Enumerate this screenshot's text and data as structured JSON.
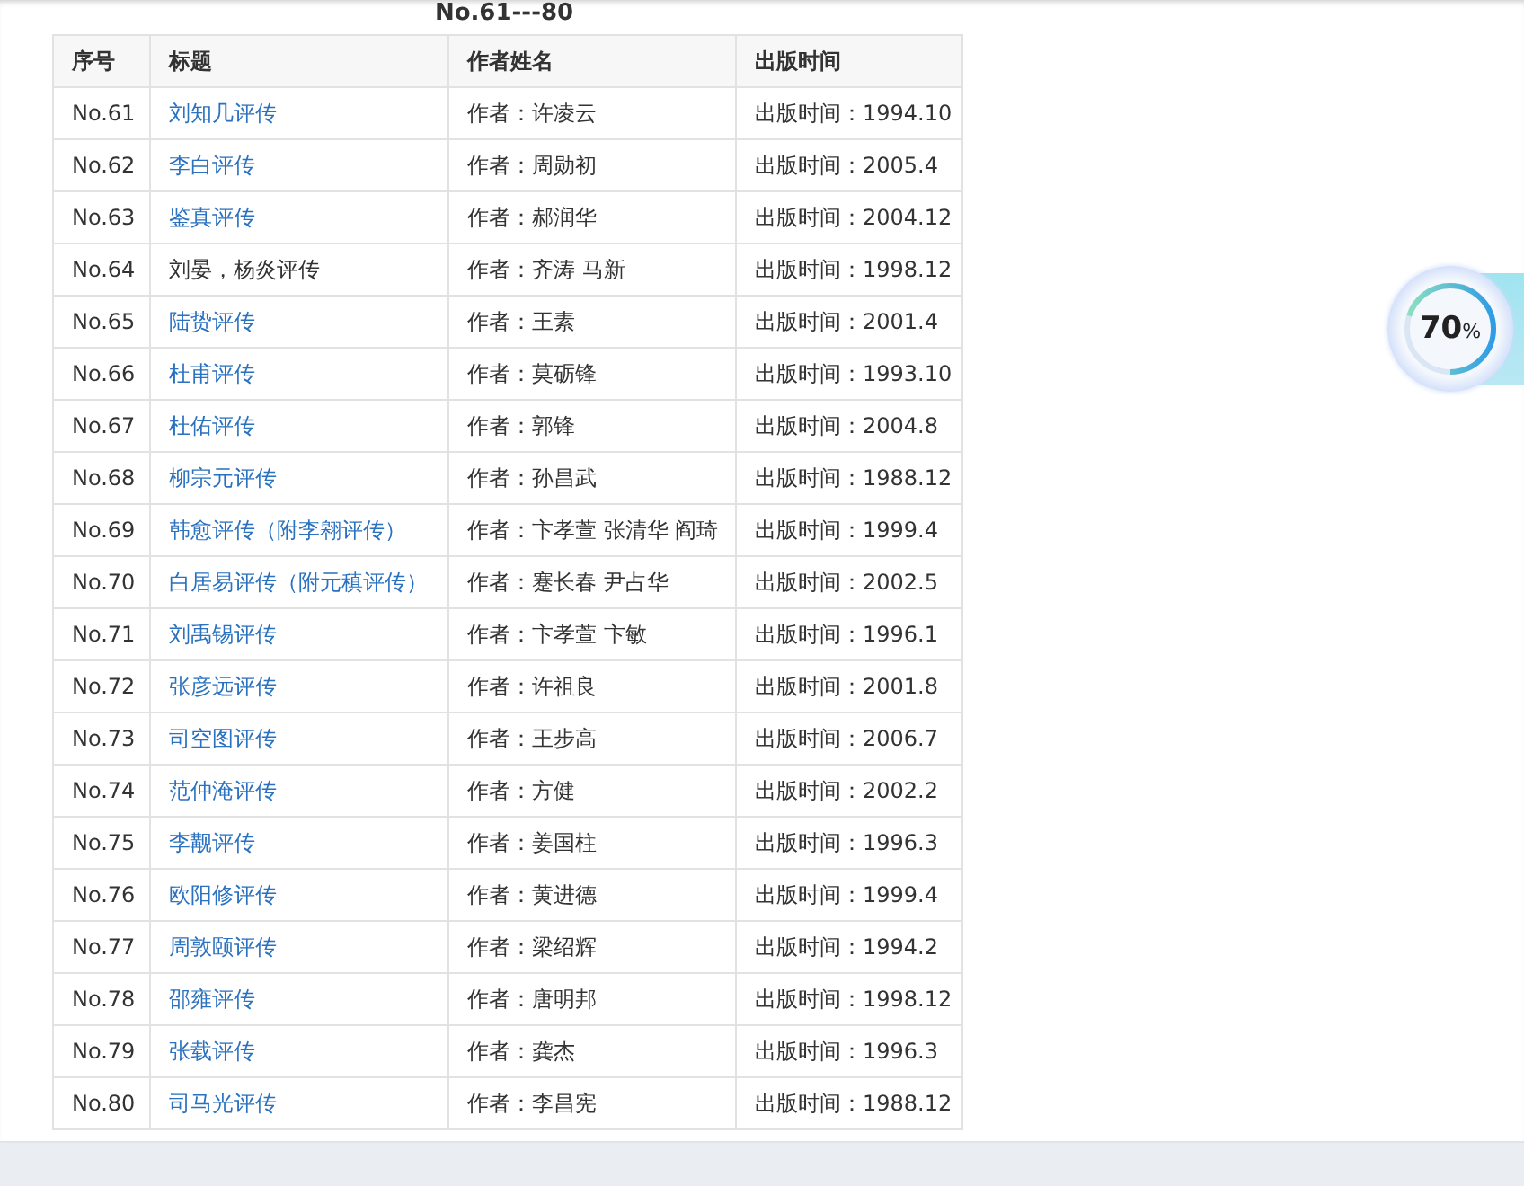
{
  "heading": "No.61---80",
  "table": {
    "columns": [
      "序号",
      "标题",
      "作者姓名",
      "出版时间"
    ],
    "rows": [
      {
        "no": "No.61",
        "title": "刘知几评传",
        "linked": true,
        "author": "作者：许凌云",
        "date": "出版时间：1994.10"
      },
      {
        "no": "No.62",
        "title": "李白评传",
        "linked": true,
        "author": "作者：周勋初",
        "date": "出版时间：2005.4"
      },
      {
        "no": "No.63",
        "title": "鉴真评传",
        "linked": true,
        "author": "作者：郝润华",
        "date": "出版时间：2004.12"
      },
      {
        "no": "No.64",
        "title": "刘晏，杨炎评传",
        "linked": false,
        "author": "作者：齐涛 马新",
        "date": "出版时间：1998.12"
      },
      {
        "no": "No.65",
        "title": "陆贽评传",
        "linked": true,
        "author": "作者：王素",
        "date": "出版时间：2001.4"
      },
      {
        "no": "No.66",
        "title": "杜甫评传",
        "linked": true,
        "author": "作者：莫砺锋",
        "date": "出版时间：1993.10"
      },
      {
        "no": "No.67",
        "title": "杜佑评传",
        "linked": true,
        "author": "作者：郭锋",
        "date": "出版时间：2004.8"
      },
      {
        "no": "No.68",
        "title": "柳宗元评传",
        "linked": true,
        "author": "作者：孙昌武",
        "date": "出版时间：1988.12"
      },
      {
        "no": "No.69",
        "title": "韩愈评传（附李翱评传）",
        "linked": true,
        "author": "作者：卞孝萱 张清华 阎琦",
        "date": "出版时间：1999.4"
      },
      {
        "no": "No.70",
        "title": "白居易评传（附元稹评传）",
        "linked": true,
        "author": "作者：蹇长春 尹占华",
        "date": "出版时间：2002.5"
      },
      {
        "no": "No.71",
        "title": "刘禹锡评传",
        "linked": true,
        "author": "作者：卞孝萱 卞敏",
        "date": "出版时间：1996.1"
      },
      {
        "no": "No.72",
        "title": "张彦远评传",
        "linked": true,
        "author": "作者：许祖良",
        "date": "出版时间：2001.8"
      },
      {
        "no": "No.73",
        "title": "司空图评传",
        "linked": true,
        "author": "作者：王步高",
        "date": "出版时间：2006.7"
      },
      {
        "no": "No.74",
        "title": "范仲淹评传",
        "linked": true,
        "author": "作者：方健",
        "date": "出版时间：2002.2"
      },
      {
        "no": "No.75",
        "title": "李觏评传",
        "linked": true,
        "author": "作者：姜国柱",
        "date": "出版时间：1996.3"
      },
      {
        "no": "No.76",
        "title": "欧阳修评传",
        "linked": true,
        "author": "作者：黄进德",
        "date": "出版时间：1999.4"
      },
      {
        "no": "No.77",
        "title": "周敦颐评传",
        "linked": true,
        "author": "作者：梁绍辉",
        "date": "出版时间：1994.2"
      },
      {
        "no": "No.78",
        "title": "邵雍评传",
        "linked": true,
        "author": "作者：唐明邦",
        "date": "出版时间：1998.12"
      },
      {
        "no": "No.79",
        "title": "张载评传",
        "linked": true,
        "author": "作者：龚杰",
        "date": "出版时间：1996.3"
      },
      {
        "no": "No.80",
        "title": "司马光评传",
        "linked": true,
        "author": "作者：李昌宪",
        "date": "出版时间：1988.12"
      }
    ]
  },
  "progress_widget": {
    "value": "70",
    "unit": "%",
    "level": 0.7
  }
}
